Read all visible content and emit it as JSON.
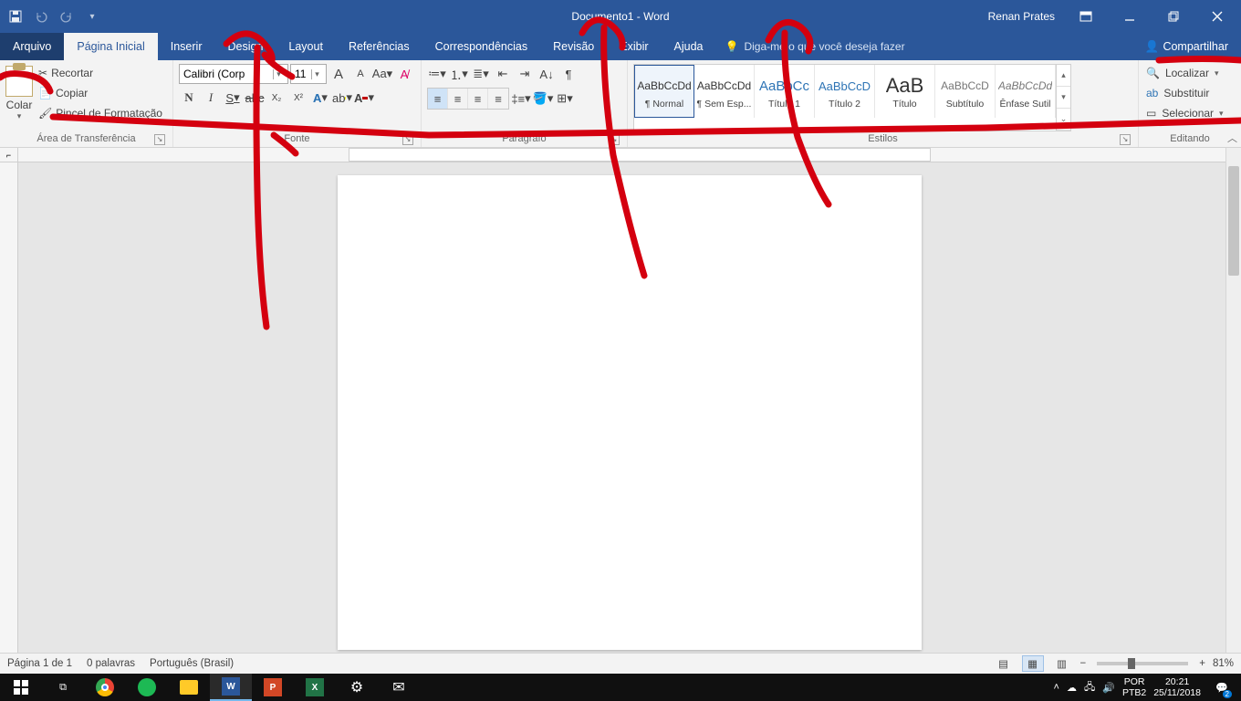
{
  "title": "Documento1  -  Word",
  "user": "Renan Prates",
  "tabs": {
    "file": "Arquivo",
    "home": "Página Inicial",
    "insert": "Inserir",
    "design": "Design",
    "layout": "Layout",
    "references": "Referências",
    "mailings": "Correspondências",
    "review": "Revisão",
    "view": "Exibir",
    "help": "Ajuda",
    "tellme": "Diga-me o que você deseja fazer",
    "share": "Compartilhar"
  },
  "clipboard": {
    "paste": "Colar",
    "cut": "Recortar",
    "copy": "Copiar",
    "format_painter": "Pincel de Formatação",
    "group": "Área de Transferência"
  },
  "font": {
    "name": "Calibri (Corp",
    "size": "11",
    "grow": "A",
    "shrink": "A",
    "case": "Aa",
    "clear": "",
    "bold": "N",
    "italic": "I",
    "underline": "S",
    "strike": "abc",
    "sub": "X₂",
    "sup": "X²",
    "group": "Fonte"
  },
  "paragraph": {
    "group": "Parágrafo"
  },
  "styles": {
    "group": "Estilos",
    "items": [
      {
        "preview": "AaBbCcDd",
        "label": "¶ Normal",
        "sel": true,
        "color": "#333"
      },
      {
        "preview": "AaBbCcDd",
        "label": "¶ Sem Esp...",
        "color": "#333"
      },
      {
        "preview": "AaBbCc",
        "label": "Título 1",
        "color": "#2e74b5",
        "size": "15px"
      },
      {
        "preview": "AaBbCcD",
        "label": "Título 2",
        "color": "#2e74b5",
        "size": "13px"
      },
      {
        "preview": "AaB",
        "label": "Título",
        "color": "#333",
        "size": "22px"
      },
      {
        "preview": "AaBbCcD",
        "label": "Subtítulo",
        "color": "#777"
      },
      {
        "preview": "AaBbCcDd",
        "label": "Ênfase Sutil",
        "color": "#777",
        "italic": true
      }
    ]
  },
  "editing": {
    "find": "Localizar",
    "replace": "Substituir",
    "select": "Selecionar",
    "group": "Editando"
  },
  "status": {
    "page": "Página 1 de 1",
    "words": "0 palavras",
    "lang": "Português (Brasil)",
    "zoom": "81%"
  },
  "taskbar": {
    "lang1": "POR",
    "lang2": "PTB2",
    "time": "20:21",
    "date": "25/11/2018",
    "notif": "2"
  }
}
